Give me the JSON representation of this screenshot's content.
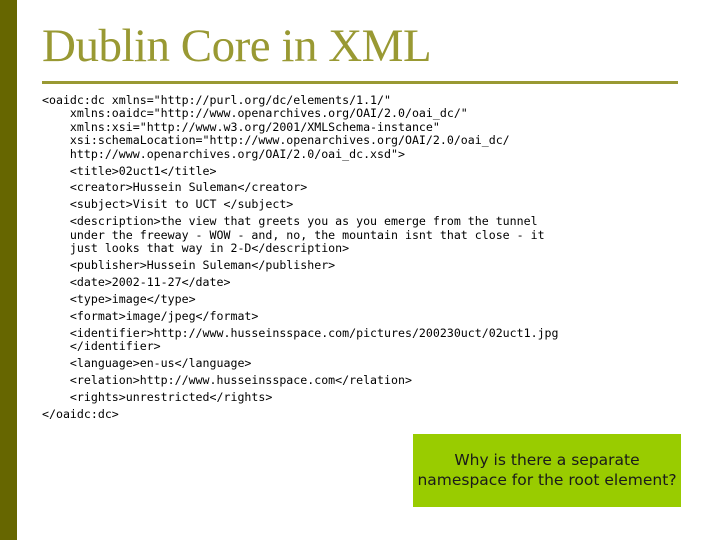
{
  "slide": {
    "title": "Dublin Core in XML",
    "colors": {
      "left_bar": "#666600",
      "title": "#999933",
      "callout_bg": "#99cc00"
    },
    "code_lines": [
      {
        "indent": 0,
        "text": "<oaidc:dc xmlns=\"http://purl.org/dc/elements/1.1/\"",
        "gap_before": false
      },
      {
        "indent": 1,
        "text": "xmlns:oaidc=\"http://www.openarchives.org/OAI/2.0/oai_dc/\"",
        "gap_before": false
      },
      {
        "indent": 1,
        "text": "xmlns:xsi=\"http://www.w3.org/2001/XMLSchema-instance\"",
        "gap_before": false
      },
      {
        "indent": 1,
        "text": "xsi:schemaLocation=\"http://www.openarchives.org/OAI/2.0/oai_dc/",
        "gap_before": false
      },
      {
        "indent": 1,
        "text": "http://www.openarchives.org/OAI/2.0/oai_dc.xsd\">",
        "gap_before": false
      },
      {
        "indent": 1,
        "text": "<title>02uct1</title>",
        "gap_before": true
      },
      {
        "indent": 1,
        "text": "<creator>Hussein Suleman</creator>",
        "gap_before": true
      },
      {
        "indent": 1,
        "text": "<subject>Visit to UCT </subject>",
        "gap_before": true
      },
      {
        "indent": 1,
        "text": "<description>the view that greets you as you emerge from the tunnel",
        "gap_before": true
      },
      {
        "indent": 1,
        "text": "under the freeway - WOW - and, no, the mountain isnt that close - it",
        "gap_before": false
      },
      {
        "indent": 1,
        "text": "just looks that way in 2-D</description>",
        "gap_before": false
      },
      {
        "indent": 1,
        "text": "<publisher>Hussein Suleman</publisher>",
        "gap_before": true
      },
      {
        "indent": 1,
        "text": "<date>2002-11-27</date>",
        "gap_before": true
      },
      {
        "indent": 1,
        "text": "<type>image</type>",
        "gap_before": true
      },
      {
        "indent": 1,
        "text": "<format>image/jpeg</format>",
        "gap_before": true
      },
      {
        "indent": 1,
        "text": "<identifier>http://www.husseinsspace.com/pictures/200230uct/02uct1.jpg",
        "gap_before": true
      },
      {
        "indent": 1,
        "text": "</identifier>",
        "gap_before": false
      },
      {
        "indent": 1,
        "text": "<language>en-us</language>",
        "gap_before": true
      },
      {
        "indent": 1,
        "text": "<relation>http://www.husseinsspace.com</relation>",
        "gap_before": true
      },
      {
        "indent": 1,
        "text": "<rights>unrestricted</rights>",
        "gap_before": true
      },
      {
        "indent": 0,
        "text": "</oaidc:dc>",
        "gap_before": true
      }
    ],
    "callout": {
      "text": "Why is there a separate namespace for the root element?"
    }
  }
}
